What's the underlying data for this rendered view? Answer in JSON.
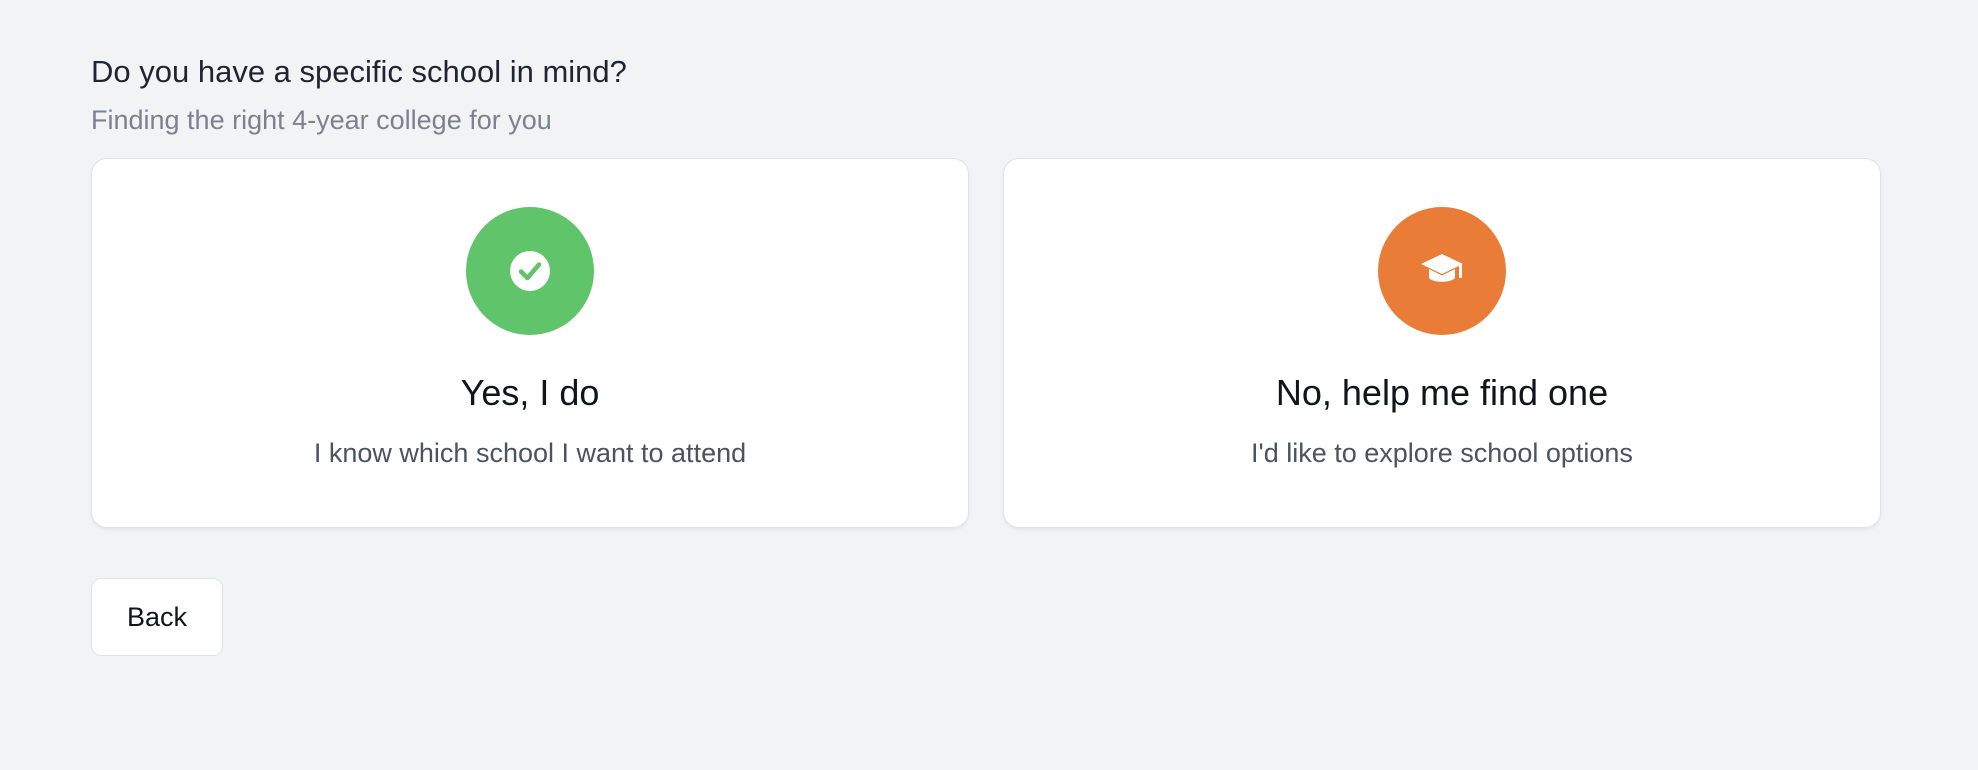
{
  "header": {
    "question": "Do you have a specific school in mind?",
    "subtitle": "Finding the right 4-year college for you"
  },
  "options": [
    {
      "title": "Yes, I do",
      "description": "I know which school I want to attend",
      "icon": "check-circle-icon",
      "color": "#5fc46a"
    },
    {
      "title": "No, help me find one",
      "description": "I'd like to explore school options",
      "icon": "graduation-cap-icon",
      "color": "#e97c36"
    }
  ],
  "footer": {
    "back_label": "Back"
  }
}
